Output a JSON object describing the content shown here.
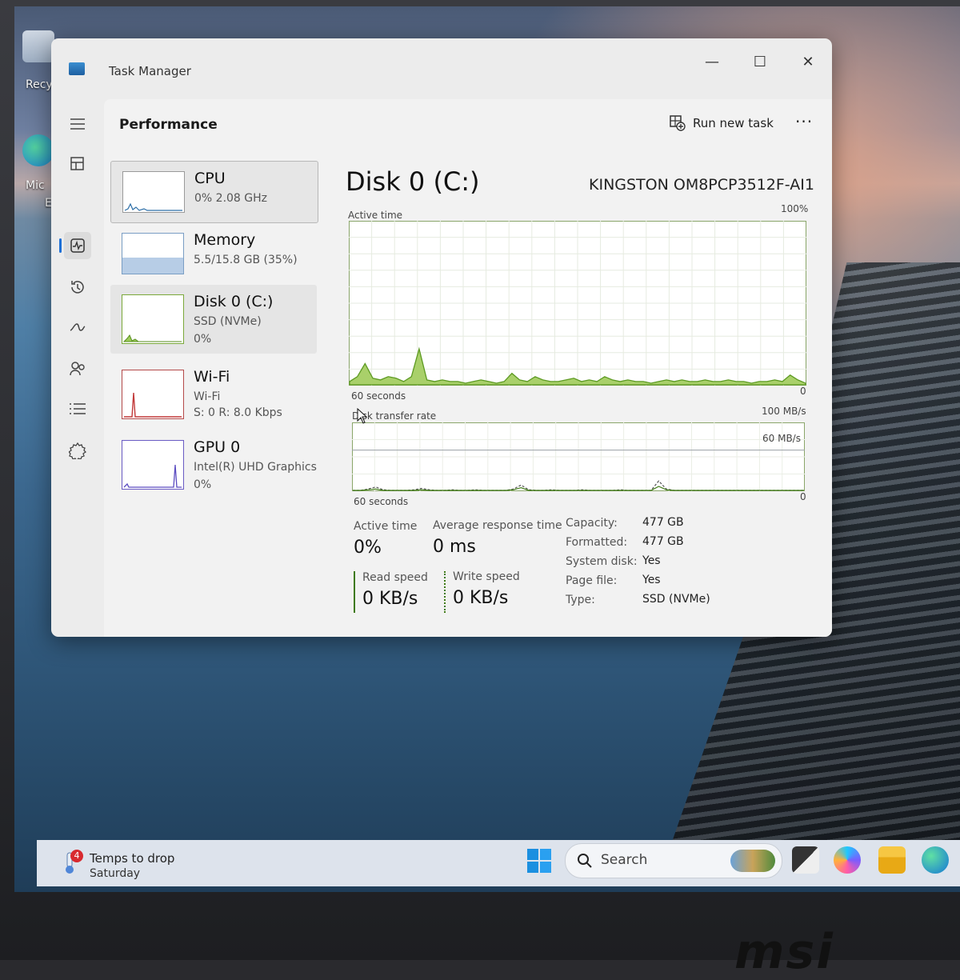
{
  "desktop": {
    "icons": [
      {
        "label": "Recy"
      },
      {
        "label": "Mic"
      },
      {
        "label": "Ec"
      }
    ]
  },
  "window": {
    "title": "Task Manager",
    "minimize": "—",
    "maximize": "☐",
    "close": "✕"
  },
  "nav": {
    "items": [
      {
        "name": "hamburger-icon"
      },
      {
        "name": "processes-icon"
      },
      {
        "name": "performance-icon",
        "active": true
      },
      {
        "name": "app-history-icon"
      },
      {
        "name": "startup-apps-icon"
      },
      {
        "name": "users-icon"
      },
      {
        "name": "details-icon"
      },
      {
        "name": "services-icon"
      },
      {
        "name": "settings-icon"
      }
    ]
  },
  "header": {
    "title": "Performance",
    "run_new_task": "Run new task",
    "more": "···"
  },
  "resources": [
    {
      "name": "CPU",
      "line1": "0%  2.08 GHz",
      "line2": ""
    },
    {
      "name": "Memory",
      "line1": "5.5/15.8 GB (35%)",
      "line2": ""
    },
    {
      "name": "Disk 0 (C:)",
      "line1": "SSD (NVMe)",
      "line2": "0%"
    },
    {
      "name": "Wi-Fi",
      "line1": "Wi-Fi",
      "line2": "S: 0  R: 8.0 Kbps"
    },
    {
      "name": "GPU 0",
      "line1": "Intel(R) UHD Graphics",
      "line2": "0%"
    }
  ],
  "detail": {
    "title": "Disk 0 (C:)",
    "model": "KINGSTON OM8PCP3512F-AI1",
    "active_chart": {
      "label": "Active time",
      "max_label": "100%",
      "time_label": "60 seconds",
      "min_label": "0"
    },
    "transfer_chart": {
      "label": "Disk transfer rate",
      "max_label": "100 MB/s",
      "mid_label": "60 MB/s",
      "time_label": "60 seconds",
      "min_label": "0"
    },
    "stats": {
      "active_time_label": "Active time",
      "active_time_value": "0%",
      "avg_response_label": "Average response time",
      "avg_response_value": "0 ms",
      "read_speed_label": "Read speed",
      "read_speed_value": "0 KB/s",
      "write_speed_label": "Write speed",
      "write_speed_value": "0 KB/s"
    },
    "properties": [
      {
        "key": "Capacity:",
        "value": "477 GB"
      },
      {
        "key": "Formatted:",
        "value": "477 GB"
      },
      {
        "key": "System disk:",
        "value": "Yes"
      },
      {
        "key": "Page file:",
        "value": "Yes"
      },
      {
        "key": "Type:",
        "value": "SSD (NVMe)"
      }
    ]
  },
  "chart_data": [
    {
      "type": "area",
      "title": "",
      "ylabel": "Active time",
      "xlabel": "60 seconds",
      "ylim": [
        0,
        100
      ],
      "series": [
        {
          "values": [
            2,
            5,
            13,
            4,
            3,
            5,
            4,
            2,
            5,
            22,
            3,
            2,
            3,
            2,
            2,
            1,
            2,
            3,
            2,
            1,
            2,
            7,
            3,
            2,
            5,
            3,
            2,
            2,
            3,
            4,
            2,
            3,
            2,
            5,
            3,
            2,
            3,
            2,
            2,
            1,
            2,
            3,
            2,
            3,
            2,
            2,
            3,
            2,
            2,
            3,
            2,
            2,
            1,
            2,
            2,
            3,
            2,
            6,
            3,
            1
          ]
        }
      ]
    },
    {
      "type": "line",
      "title": "",
      "ylabel": "Disk transfer rate",
      "xlabel": "60 seconds",
      "ylim": [
        0,
        100
      ],
      "series": [
        {
          "values": [
            0,
            0,
            2,
            5,
            1,
            0,
            0,
            0,
            1,
            3,
            1,
            0,
            0,
            1,
            0,
            0,
            1,
            0,
            0,
            0,
            0,
            2,
            8,
            1,
            0,
            0,
            1,
            0,
            0,
            0,
            1,
            0,
            0,
            0,
            0,
            1,
            0,
            0,
            0,
            0,
            14,
            2,
            0,
            0,
            0,
            0,
            0,
            0,
            0,
            0,
            0,
            0,
            0,
            0,
            0,
            0,
            0,
            0,
            0,
            0
          ]
        },
        {
          "values": [
            0,
            0,
            1,
            2,
            0,
            0,
            0,
            0,
            0,
            1,
            0,
            0,
            0,
            0,
            0,
            0,
            0,
            0,
            0,
            0,
            0,
            1,
            4,
            0,
            0,
            0,
            0,
            0,
            0,
            0,
            0,
            0,
            0,
            0,
            0,
            0,
            0,
            0,
            0,
            0,
            6,
            1,
            0,
            0,
            0,
            0,
            0,
            0,
            0,
            0,
            0,
            0,
            0,
            0,
            0,
            0,
            0,
            0,
            0,
            0
          ]
        }
      ]
    }
  ],
  "taskbar": {
    "weather_line1": "Temps to drop",
    "weather_line2": "Saturday",
    "weather_badge": "4",
    "search_label": "Search"
  },
  "bezel": {
    "logo": "msi"
  }
}
